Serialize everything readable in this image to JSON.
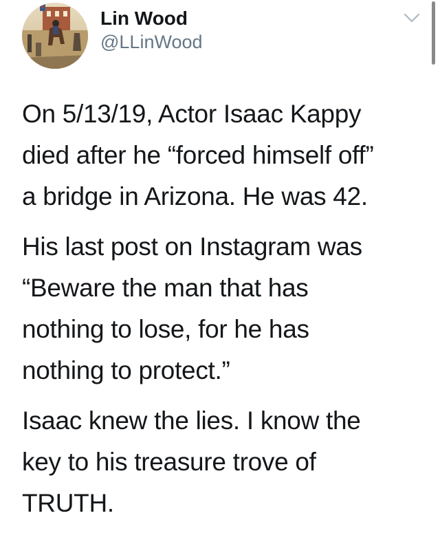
{
  "author": {
    "name": "Lin Wood",
    "handle": "@LLinWood",
    "avatar_icon": "painting-horse-rider-avatar"
  },
  "menu": {
    "icon": "chevron-down-icon"
  },
  "tweet": {
    "paragraphs": [
      "On 5/13/19, Actor Isaac Kappy\ndied after he “forced himself off”\na bridge in Arizona. He was 42.",
      "His last post on Instagram was\n“Beware the man that has\nnothing to lose, for he has\nnothing to protect.”",
      "Isaac knew the lies. I know the\nkey to his treasure trove of\nTRUTH."
    ]
  },
  "colors": {
    "text": "#14171a",
    "secondary": "#657786",
    "background": "#ffffff",
    "caret": "#aab8c2"
  }
}
